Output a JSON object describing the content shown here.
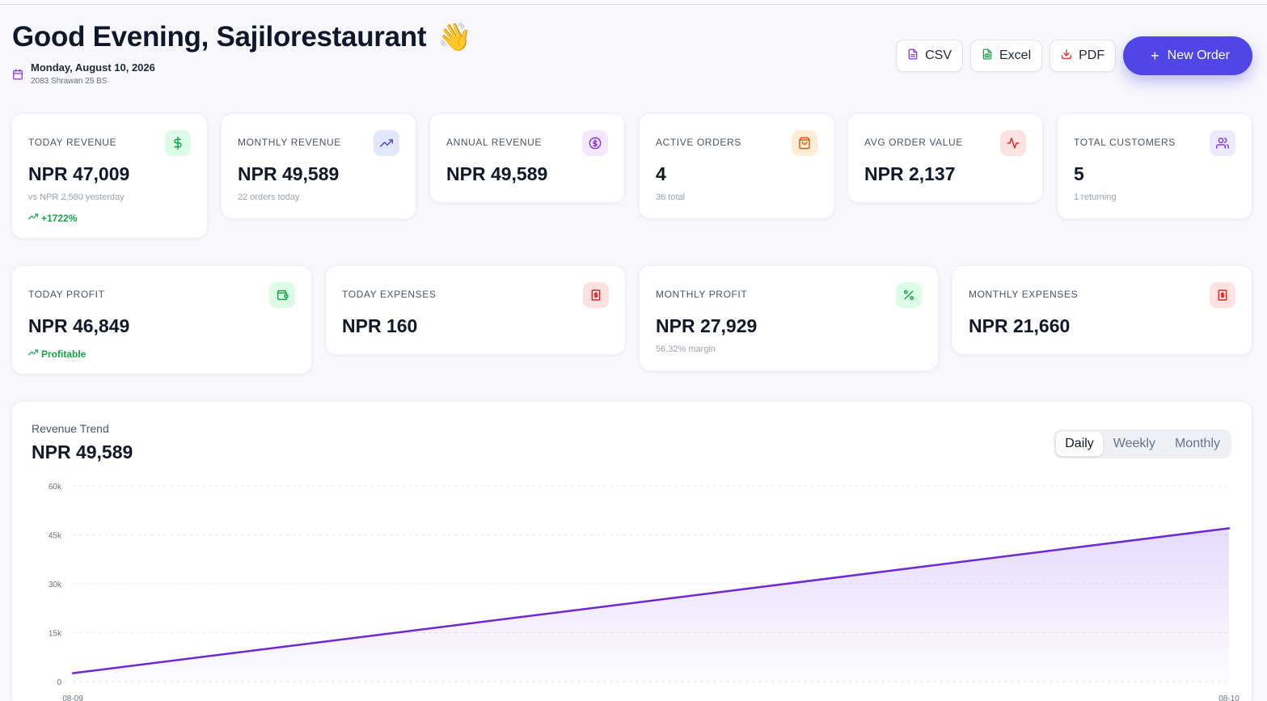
{
  "header": {
    "greeting": "Good Evening, Sajilorestaurant",
    "wave_emoji": "👋",
    "date_ad": "Monday, August 10, 2026",
    "date_bs": "2083 Shrawan 25 BS"
  },
  "actions": {
    "csv": "CSV",
    "excel": "Excel",
    "pdf": "PDF",
    "new_order": "New Order"
  },
  "stats_row1": [
    {
      "label": "Today Revenue",
      "value": "NPR 47,009",
      "sub": "vs NPR 2,580 yesterday",
      "trend": "+1722%",
      "icon": "dollar-icon",
      "color": "#16a34a"
    },
    {
      "label": "Monthly Revenue",
      "value": "NPR 49,589",
      "sub": "22 orders today",
      "icon": "trending-up-icon",
      "color": "#4f46e5"
    },
    {
      "label": "Annual Revenue",
      "value": "NPR 49,589",
      "icon": "coin-icon",
      "color": "#9333ea"
    },
    {
      "label": "Active Orders",
      "value": "4",
      "sub": "36 total",
      "icon": "shopping-bag-icon",
      "color": "#ea580c"
    },
    {
      "label": "Avg Order Value",
      "value": "NPR 2,137",
      "icon": "activity-icon",
      "color": "#dc2626"
    },
    {
      "label": "Total Customers",
      "value": "5",
      "sub": "1 returning",
      "icon": "users-icon",
      "color": "#7c3aed"
    }
  ],
  "stats_row2": [
    {
      "label": "Today Profit",
      "value": "NPR 46,849",
      "trend": "Profitable",
      "icon": "wallet-icon",
      "color": "#16a34a"
    },
    {
      "label": "Today Expenses",
      "value": "NPR 160",
      "icon": "receipt-icon",
      "color": "#dc2626"
    },
    {
      "label": "Monthly Profit",
      "value": "NPR 27,929",
      "sub": "56.32% margin",
      "icon": "percent-icon",
      "color": "#16a34a"
    },
    {
      "label": "Monthly Expenses",
      "value": "NPR 21,660",
      "icon": "receipt-icon",
      "color": "#dc2626"
    }
  ],
  "revenue_trend": {
    "title": "Revenue Trend",
    "total": "NPR 49,589",
    "tabs": [
      "Daily",
      "Weekly",
      "Monthly"
    ],
    "active_tab": "Daily"
  },
  "chart_data": {
    "type": "area",
    "title": "Revenue Trend",
    "x": [
      "08-09",
      "08-10"
    ],
    "series": [
      {
        "values": [
          2580,
          47009
        ]
      }
    ],
    "ylim": [
      0,
      60000
    ],
    "y_ticks": [
      "0",
      "15k",
      "30k",
      "45k",
      "60k"
    ],
    "grid": true,
    "color": "#6d28d9"
  }
}
